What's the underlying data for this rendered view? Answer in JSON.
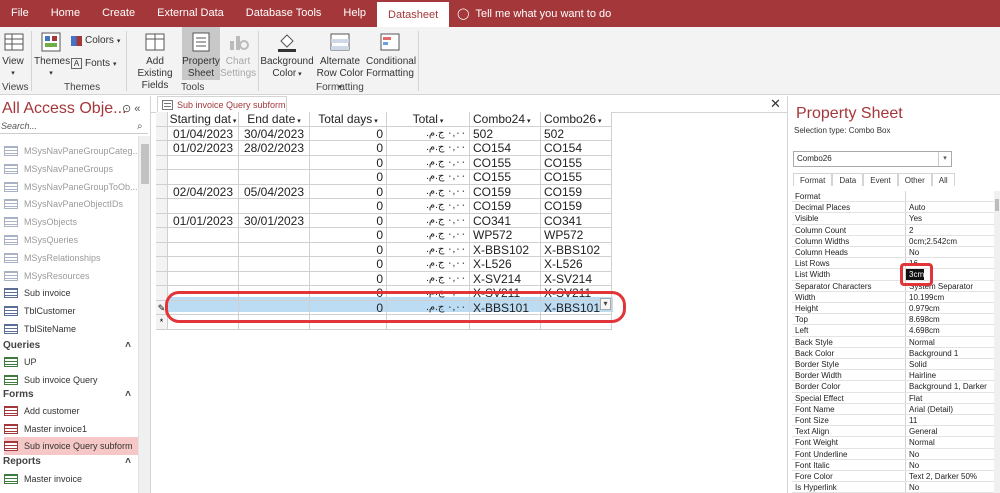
{
  "ribbon_tabs": [
    "File",
    "Home",
    "Create",
    "External Data",
    "Database Tools",
    "Help",
    "Datasheet"
  ],
  "active_tab": "Datasheet",
  "tell_me": "Tell me what you want to do",
  "ribbon": {
    "view": {
      "label": "View",
      "group": "Views"
    },
    "themes": {
      "label": "Themes",
      "colors": "Colors",
      "fonts": "Fonts",
      "group": "Themes"
    },
    "tools": {
      "add_existing": "Add Existing Fields",
      "property_sheet": "Property Sheet",
      "chart_settings": "Chart Settings",
      "group": "Tools"
    },
    "formatting": {
      "background": "Background Color",
      "alternate": "Alternate Row Color",
      "conditional": "Conditional Formatting",
      "group": "Formatting"
    }
  },
  "nav": {
    "title": "All Access Obje...",
    "search_placeholder": "Search...",
    "tables": [
      {
        "label": "MSysNavPaneGroupCateg...",
        "sys": true
      },
      {
        "label": "MSysNavPaneGroups",
        "sys": true
      },
      {
        "label": "MSysNavPaneGroupToOb...",
        "sys": true
      },
      {
        "label": "MSysNavPaneObjectIDs",
        "sys": true
      },
      {
        "label": "MSysObjects",
        "sys": true
      },
      {
        "label": "MSysQueries",
        "sys": true
      },
      {
        "label": "MSysRelationships",
        "sys": true
      },
      {
        "label": "MSysResources",
        "sys": true
      },
      {
        "label": "Sub invoice",
        "sys": false
      },
      {
        "label": "TblCustomer",
        "sys": false
      },
      {
        "label": "TblSiteName",
        "sys": false
      }
    ],
    "queries_header": "Queries",
    "queries": [
      "UP",
      "Sub invoice Query"
    ],
    "forms_header": "Forms",
    "forms": [
      "Add customer",
      "Master invoice1",
      "Sub invoice Query subform"
    ],
    "reports_header": "Reports",
    "reports": [
      "Master invoice"
    ]
  },
  "document": {
    "tab_label": "Sub invoice Query subform",
    "columns": [
      "Starting dat",
      "End date",
      "Total days",
      "Total",
      "Combo24",
      "Combo26"
    ],
    "rows": [
      [
        "01/04/2023",
        "30/04/2023",
        "0",
        "٠,٠٠ ج.م.‏",
        "502",
        "502"
      ],
      [
        "01/02/2023",
        "28/02/2023",
        "0",
        "٠,٠٠ ج.م.‏",
        "CO154",
        "CO154"
      ],
      [
        "",
        "",
        "0",
        "٠,٠٠ ج.م.‏",
        "CO155",
        "CO155"
      ],
      [
        "",
        "",
        "0",
        "٠,٠٠ ج.م.‏",
        "CO155",
        "CO155"
      ],
      [
        "02/04/2023",
        "05/04/2023",
        "0",
        "٠,٠٠ ج.م.‏",
        "CO159",
        "CO159"
      ],
      [
        "",
        "",
        "0",
        "٠,٠٠ ج.م.‏",
        "CO159",
        "CO159"
      ],
      [
        "01/01/2023",
        "30/01/2023",
        "0",
        "٠,٠٠ ج.م.‏",
        "CO341",
        "CO341"
      ],
      [
        "",
        "",
        "0",
        "٠,٠٠ ج.م.‏",
        "WP572",
        "WP572"
      ],
      [
        "",
        "",
        "0",
        "٠,٠٠ ج.م.‏",
        "X-BBS102",
        "X-BBS102"
      ],
      [
        "",
        "",
        "0",
        "٠,٠٠ ج.م.‏",
        "X-L526",
        "X-L526"
      ],
      [
        "",
        "",
        "0",
        "٠,٠٠ ج.م.‏",
        "X-SV214",
        "X-SV214"
      ],
      [
        "",
        "",
        "0",
        "٠,٠٠ ج.م.‏",
        "X-SV211",
        "X-SV211"
      ],
      [
        "",
        "",
        "0",
        "٠,٠٠ ج.م.‏",
        "X-BBS101",
        "X-BBS101"
      ]
    ]
  },
  "property_sheet": {
    "title": "Property Sheet",
    "selection_type": "Selection type:  Combo Box",
    "selected_control": "Combo26",
    "tabs": [
      "Format",
      "Data",
      "Event",
      "Other",
      "All"
    ],
    "active_tab": "Format",
    "properties": [
      [
        "Format",
        ""
      ],
      [
        "Decimal Places",
        "Auto"
      ],
      [
        "Visible",
        "Yes"
      ],
      [
        "Column Count",
        "2"
      ],
      [
        "Column Widths",
        "0cm;2.542cm"
      ],
      [
        "Column Heads",
        "No"
      ],
      [
        "List Rows",
        "16"
      ],
      [
        "List Width",
        "3cm"
      ],
      [
        "Separator Characters",
        "System Separator"
      ],
      [
        "Width",
        "10.199cm"
      ],
      [
        "Height",
        "0.979cm"
      ],
      [
        "Top",
        "8.698cm"
      ],
      [
        "Left",
        "4.698cm"
      ],
      [
        "Back Style",
        "Normal"
      ],
      [
        "Back Color",
        "Background 1"
      ],
      [
        "Border Style",
        "Solid"
      ],
      [
        "Border Width",
        "Hairline"
      ],
      [
        "Border Color",
        "Background 1, Darker"
      ],
      [
        "Special Effect",
        "Flat"
      ],
      [
        "Font Name",
        "Arial (Detail)"
      ],
      [
        "Font Size",
        "11"
      ],
      [
        "Text Align",
        "General"
      ],
      [
        "Font Weight",
        "Normal"
      ],
      [
        "Font Underline",
        "No"
      ],
      [
        "Font Italic",
        "No"
      ],
      [
        "Fore Color",
        "Text 2, Darker 50%"
      ],
      [
        "Is Hyperlink",
        "No"
      ]
    ]
  },
  "colors": {
    "accent": "#a4373a",
    "highlight_row": "#bcdcf4",
    "annotation": "#e1353a"
  }
}
